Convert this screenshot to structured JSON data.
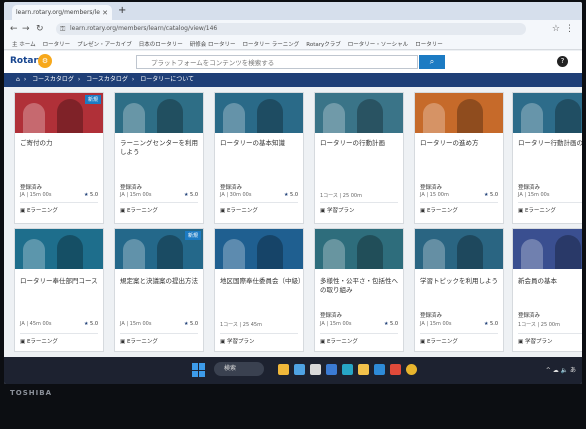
{
  "browser": {
    "tab_title": "learn.rotary.org/members/learn/...",
    "new_tab": "+",
    "url": "learn.rotary.org/members/learn/catalog/view/146",
    "bookmarks": [
      "主 ホーム",
      "ロータリー",
      "プレゼン・アーカイブ",
      "日本のロータリー",
      "研修会 ロータリー",
      "ロータリー ラーニング",
      "Rotaryクラブ",
      "ロータリー・ソーシャル",
      "ロータリー"
    ]
  },
  "site": {
    "logo": "Rotary",
    "search_placeholder": "プラットフォームをコンテンツを検索する",
    "breadcrumb": [
      "ホーム",
      "コースカタログ",
      "コースカタログ",
      "ロータリーについて"
    ]
  },
  "courses": [
    {
      "title": "ご寄付の力",
      "status": "登録済み",
      "meta": "JA | 15m 00s",
      "rating": "5.0",
      "type": "Eラーニング",
      "color": "#b03038",
      "badge": "新規"
    },
    {
      "title": "ラーニングセンターを利用しよう",
      "status": "登録済み",
      "meta": "JA | 15m 00s",
      "rating": "5.0",
      "type": "Eラーニング",
      "color": "#2e6e86",
      "badge": ""
    },
    {
      "title": "ロータリーの基本知識",
      "status": "登録済み",
      "meta": "JA | 30m 00s",
      "rating": "5.0",
      "type": "Eラーニング",
      "color": "#2a6a88",
      "badge": ""
    },
    {
      "title": "ロータリーの行動計画",
      "status": "",
      "meta": "1コース | 25 00m",
      "rating": "",
      "type": "学習プラン",
      "color": "#3a7488",
      "badge": ""
    },
    {
      "title": "ロータリーの進め方",
      "status": "登録済み",
      "meta": "JA | 15 00m",
      "rating": "5.0",
      "type": "Eラーニング",
      "color": "#c66a2a",
      "badge": ""
    },
    {
      "title": "ロータリー行動計画の",
      "status": "登録済み",
      "meta": "JA | 15m 00s",
      "rating": "",
      "type": "Eラーニング",
      "color": "#2d6c8a",
      "badge": ""
    },
    {
      "title": "ロータリー奉仕部門コース",
      "status": "",
      "meta": "JA | 45m 00s",
      "rating": "5.0",
      "type": "Eラーニング",
      "color": "#1e6e8c",
      "badge": ""
    },
    {
      "title": "規定案と決議案の提出方法",
      "status": "",
      "meta": "JA | 15m 00s",
      "rating": "5.0",
      "type": "Eラーニング",
      "color": "#24688a",
      "badge": "新規"
    },
    {
      "title": "地区国際奉仕委員会（中級）",
      "status": "",
      "meta": "1コース | 25 45m",
      "rating": "",
      "type": "学習プラン",
      "color": "#1f5f90",
      "badge": ""
    },
    {
      "title": "多様性・公平さ・包括性への取り組み",
      "status": "登録済み",
      "meta": "JA | 15m 00s",
      "rating": "5.0",
      "type": "Eラーニング",
      "color": "#2e6d7c",
      "badge": ""
    },
    {
      "title": "学習トピックを利用しよう",
      "status": "登録済み",
      "meta": "JA | 15m 00s",
      "rating": "5.0",
      "type": "Eラーニング",
      "color": "#2a6582",
      "badge": ""
    },
    {
      "title": "新会員の基本",
      "status": "登録済み",
      "meta": "1コース | 25 00m",
      "rating": "",
      "type": "学習プラン",
      "color": "#3a4f90",
      "badge": ""
    }
  ],
  "taskbar": {
    "search": "検索",
    "tray": "^ ☁ 🔈 あ"
  },
  "device_brand": "TOSHIBA"
}
